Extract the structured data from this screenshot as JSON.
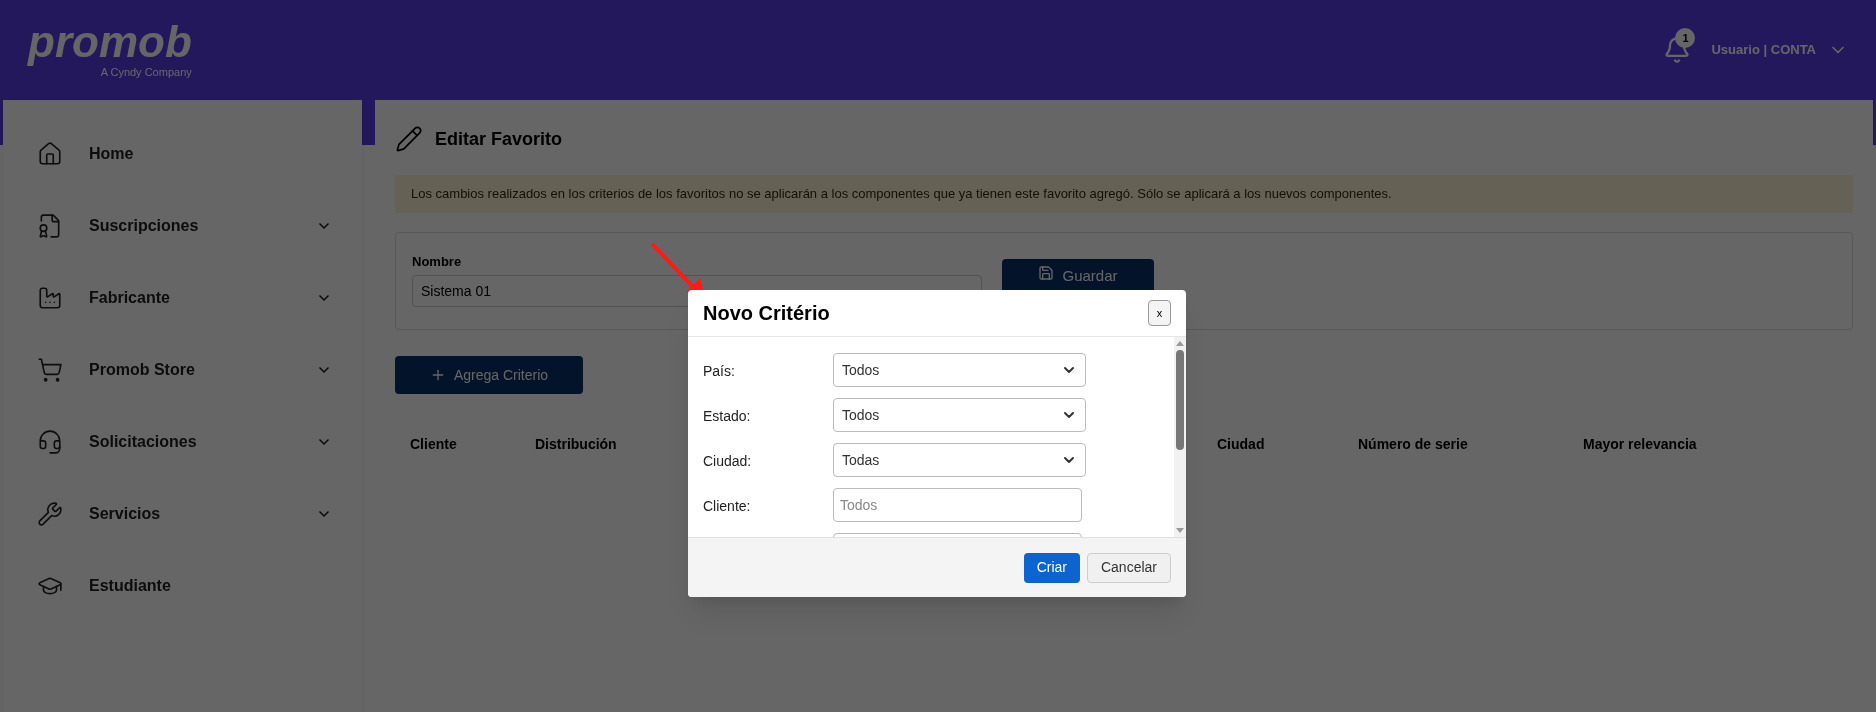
{
  "header": {
    "logo": "promob",
    "logo_tagline": "A Cyndy Company",
    "notifications": "1",
    "user": "Usuario | CONTA"
  },
  "sidebar": {
    "items": [
      {
        "label": "Home",
        "expandable": false
      },
      {
        "label": "Suscripciones",
        "expandable": true
      },
      {
        "label": "Fabricante",
        "expandable": true
      },
      {
        "label": "Promob Store",
        "expandable": true
      },
      {
        "label": "Solicitaciones",
        "expandable": true
      },
      {
        "label": "Servicios",
        "expandable": true
      },
      {
        "label": "Estudiante",
        "expandable": false
      }
    ]
  },
  "page": {
    "title": "Editar Favorito",
    "notice": "Los cambios realizados en los criterios de los favoritos no se aplicarán a los componentes que ya tienen este favorito agregó. Sólo se aplicará a los nuevos componentes.",
    "name_label": "Nombre",
    "name_value": "Sistema 01",
    "save_button": "Guardar",
    "add_button": "Agrega Criterio",
    "table": {
      "columns": [
        "Cliente",
        "Distribución",
        "Ciudad",
        "Número de serie",
        "Mayor relevancia"
      ]
    }
  },
  "dialog": {
    "title": "Novo Critério",
    "close": "x",
    "fields": [
      {
        "kind": "select",
        "label": "País:",
        "value": "Todos"
      },
      {
        "kind": "select",
        "label": "Estado:",
        "value": "Todos"
      },
      {
        "kind": "select",
        "label": "Ciudad:",
        "value": "Todas"
      },
      {
        "kind": "text",
        "label": "Cliente:",
        "placeholder": "Todos"
      },
      {
        "kind": "text"
      }
    ],
    "buttons": [
      {
        "label": "Criar",
        "primary": true
      },
      {
        "label": "Cancelar",
        "primary": false
      }
    ]
  }
}
